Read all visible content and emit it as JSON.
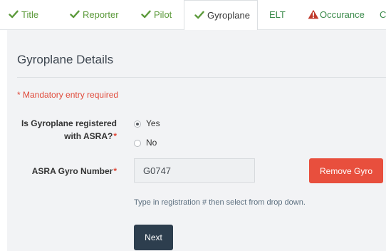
{
  "tabs": [
    {
      "label": "Title",
      "status": "complete"
    },
    {
      "label": "Reporter",
      "status": "complete"
    },
    {
      "label": "Pilot",
      "status": "complete"
    },
    {
      "label": "Gyroplane",
      "status": "complete",
      "active": true
    },
    {
      "label": "ELT",
      "status": "none"
    },
    {
      "label": "Occurance",
      "status": "warning"
    },
    {
      "label": "C",
      "status": "none"
    }
  ],
  "panel": {
    "title": "Gyroplane Details",
    "mandatory_note": "* Mandatory entry required"
  },
  "registered": {
    "label_line1": "Is Gyroplane registered",
    "label_line2": "with ASRA?",
    "required_mark": "*",
    "options": [
      "Yes",
      "No"
    ],
    "selected": "Yes"
  },
  "gyro_number": {
    "label": "ASRA Gyro Number",
    "required_mark": "*",
    "value": "G0747",
    "hint": "Type in registration # then select from drop down."
  },
  "buttons": {
    "remove": "Remove Gyro",
    "next": "Next"
  },
  "colors": {
    "complete": "#5c9a3b",
    "warning": "#c0392b",
    "danger_button": "#e84f3d",
    "primary_button": "#2d3e4e"
  }
}
